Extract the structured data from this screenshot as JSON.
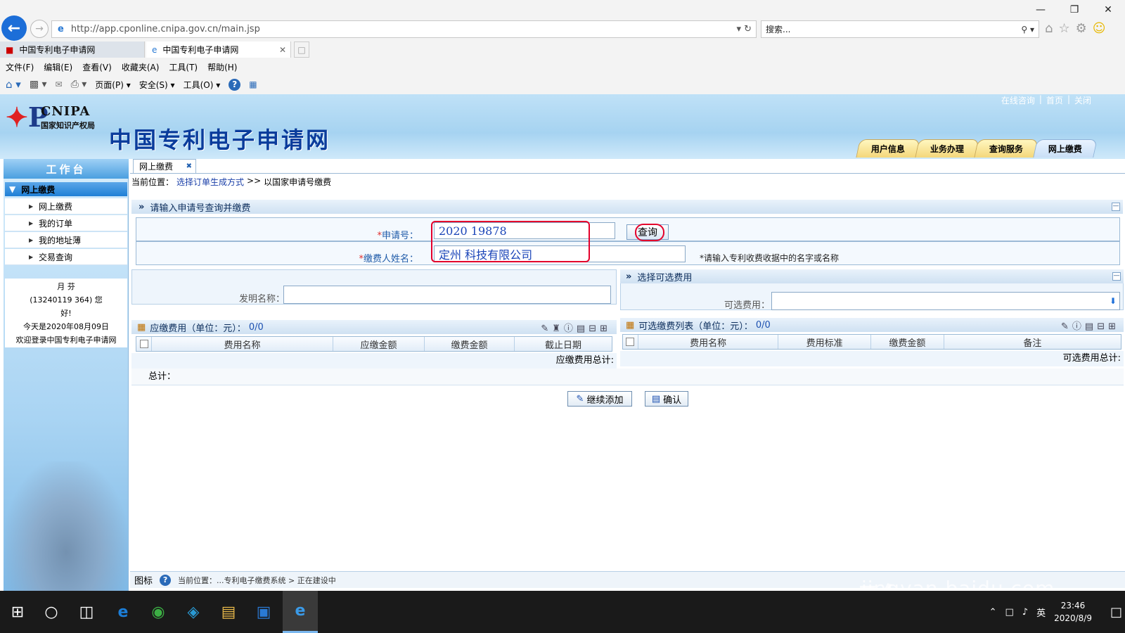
{
  "browser": {
    "url": "http://app.cponline.cnipa.gov.cn/main.jsp",
    "search_placeholder": "搜索...",
    "tabs": [
      {
        "label": "中国专利电子申请网"
      },
      {
        "label": "中国专利电子申请网"
      }
    ],
    "menu": [
      "文件(F)",
      "编辑(E)",
      "查看(V)",
      "收藏夹(A)",
      "工具(T)",
      "帮助(H)"
    ],
    "commands": {
      "page": "页面(P)",
      "safety": "安全(S)",
      "tools": "工具(O)"
    }
  },
  "header": {
    "logo_en": "CNIPA",
    "logo_cn": "国家知识产权局",
    "site_title": "中国专利电子申请网",
    "top_links": [
      "在线咨询",
      "|",
      "首页",
      "|",
      "关闭"
    ],
    "nav_tabs": [
      "用户信息",
      "业务办理",
      "查询服务",
      "网上缴费"
    ],
    "active_tab": "网上缴费"
  },
  "sidebar": {
    "title": "工作台",
    "section": "网上缴费",
    "items": [
      "网上缴费",
      "我的订单",
      "我的地址薄",
      "交易查询"
    ],
    "user": {
      "name": "月      芬",
      "id_line": "(13240119     364)   您",
      "greeting": "好!",
      "date_line": "今天是2020年08月09日",
      "welcome": "欢迎登录中国专利电子申请网"
    }
  },
  "main": {
    "tab_label": "网上缴费",
    "breadcrumb": {
      "prefix": "当前位置：",
      "link": "选择订单生成方式",
      "sep": ">>",
      "current": "以国家申请号缴费"
    },
    "query_panel": {
      "title": "请输入申请号查询并缴费",
      "app_no_label": "申请号：",
      "app_no_value": "2020     19878",
      "payer_label": "缴费人姓名：",
      "payer_value": "定州      科技有限公司",
      "query_button": "查询",
      "payer_hint": "*请输入专利收费收据中的名字或名称"
    },
    "invention": {
      "label": "发明名称：",
      "value": ""
    },
    "optional_select": {
      "title": "选择可选费用",
      "label": "可选费用：",
      "value": ""
    },
    "due_fees": {
      "title": "应缴费用（单位：元）：",
      "count": "0/0",
      "columns": [
        "费用名称",
        "应缴金额",
        "缴费金额",
        "截止日期"
      ],
      "total_label": "应缴费用总计:"
    },
    "optional_fees": {
      "title": "可选缴费列表（单位：元）：",
      "count": "0/0",
      "columns": [
        "费用名称",
        "费用标准",
        "缴费金额",
        "备注"
      ],
      "total_label": "可选费用总计:"
    },
    "grand_total_label": "总计：",
    "buttons": {
      "add_more": "继续添加",
      "confirm": "确认"
    },
    "status": {
      "legend": "图标",
      "text": "当前位置：...专利电子缴费系统 > 正在建设中"
    }
  },
  "taskbar": {
    "ime": "英",
    "time": "23:46",
    "date": "2020/8/9"
  },
  "watermark": {
    "main": "Bai du 经验",
    "sub": "jingyan.baidu.com"
  },
  "colors": {
    "accent": "#1f7fd6",
    "highlight": "#e4002b",
    "title": "#0a3c9c"
  }
}
